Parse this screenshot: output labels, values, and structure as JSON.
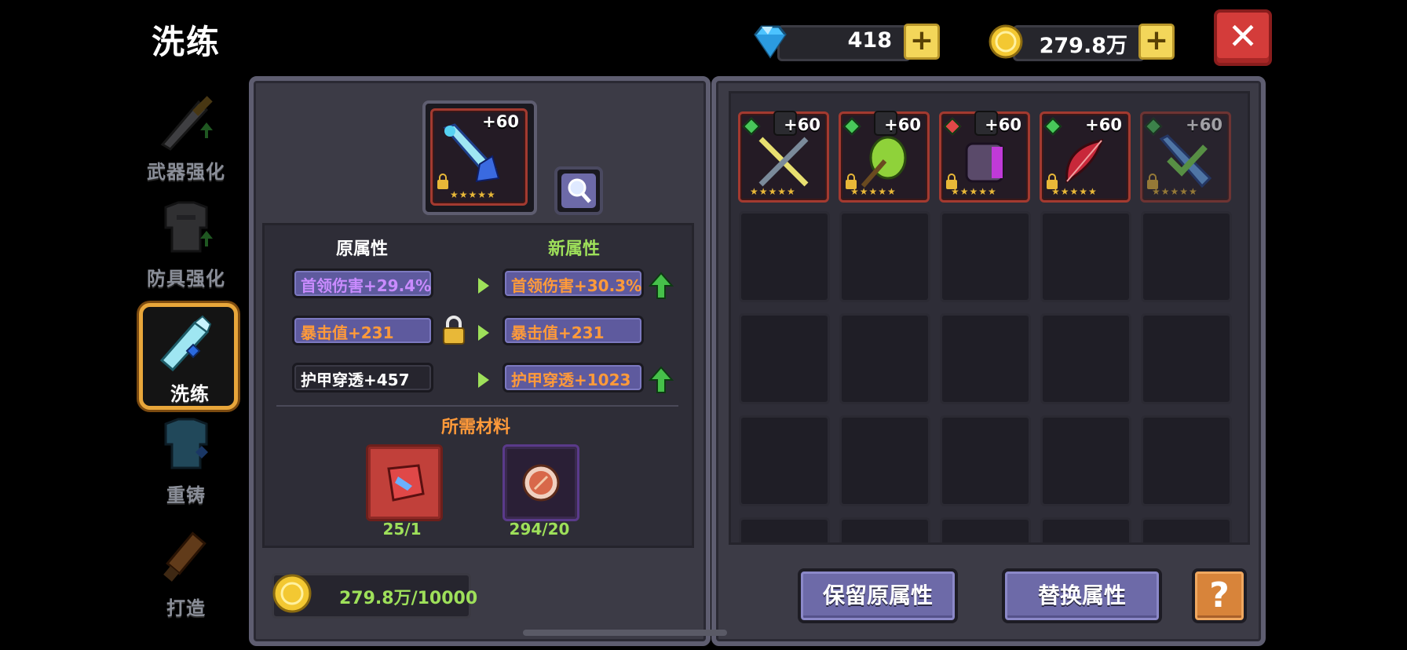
{
  "header": {
    "title": "洗练"
  },
  "currency": {
    "diamond": {
      "value": "418",
      "icon": "diamond-icon",
      "color": "#4cc3ff"
    },
    "gold": {
      "value": "279.8万",
      "icon": "gold-coin-icon",
      "color": "#f3c832"
    }
  },
  "nav": [
    {
      "label": "武器强化",
      "icon": "sword-upgrade-icon",
      "active": false
    },
    {
      "label": "防具强化",
      "icon": "armor-upgrade-icon",
      "active": false
    },
    {
      "label": "洗练",
      "icon": "refine-sword-icon",
      "active": true
    },
    {
      "label": "重铸",
      "icon": "recast-armor-icon",
      "active": false
    },
    {
      "label": "打造",
      "icon": "forge-hammer-icon",
      "active": false
    }
  ],
  "refine": {
    "item": {
      "level": "+60",
      "stars": "★★★★★",
      "icon": "ice-sword-icon"
    },
    "magnify_icon": "magnify-icon",
    "old_header": "原属性",
    "new_header": "新属性",
    "rows": [
      {
        "old": "首领伤害+29.4%",
        "new": "首领伤害+30.3%",
        "locked": false,
        "up": true,
        "old_color": "#c98bff",
        "new_color": "#ff9a3a"
      },
      {
        "old": "暴击值+231",
        "new": "暴击值+231",
        "locked": true,
        "up": false,
        "old_color": "#ff9a3a",
        "new_color": "#ff9a3a"
      },
      {
        "old": "护甲穿透+457",
        "new": "护甲穿透+1023",
        "locked": false,
        "up": true,
        "old_color": "#ffffff",
        "new_color": "#ff9a3a"
      }
    ],
    "materials_header": "所需材料",
    "materials": [
      {
        "count": "25/1",
        "icon": "refine-stone-icon"
      },
      {
        "count": "294/20",
        "icon": "orb-icon"
      }
    ],
    "gold_cost": "279.8万/10000"
  },
  "inventory": {
    "items": [
      {
        "level": "+60",
        "stars": "★★★★★",
        "gem": "#48c85a",
        "icon": "cross-swords-icon",
        "badge": true
      },
      {
        "level": "+60",
        "stars": "★★★★★",
        "gem": "#48c85a",
        "icon": "green-axe-icon",
        "badge": true
      },
      {
        "level": "+60",
        "stars": "★★★★★",
        "gem": "#e04848",
        "icon": "purple-gauntlet-icon",
        "badge": true
      },
      {
        "level": "+60",
        "stars": "★★★★★",
        "gem": "#48c85a",
        "icon": "red-bow-icon",
        "badge": false
      },
      {
        "level": "+60",
        "stars": "★★★★★",
        "gem": "#48c85a",
        "icon": "blue-spear-icon",
        "badge": false,
        "selected": true
      }
    ]
  },
  "buttons": {
    "keep": "保留原属性",
    "replace": "替换属性",
    "help": "?"
  }
}
